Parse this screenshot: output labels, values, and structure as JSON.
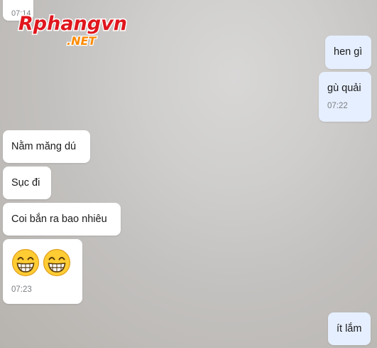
{
  "watermark": {
    "text_main": "Rphangvn",
    "text_sub": ".NET",
    "colors": {
      "main": "#e0161e",
      "sub": "#ff8a00",
      "outline": "#ffffff"
    }
  },
  "messages": [
    {
      "side": "incoming",
      "time": "07:14"
    },
    {
      "side": "outgoing",
      "text": "hen gì"
    },
    {
      "side": "outgoing",
      "text": "gù quải",
      "time": "07:22"
    },
    {
      "side": "incoming",
      "text": "Nằm măng dú"
    },
    {
      "side": "incoming",
      "text": "Sục đi"
    },
    {
      "side": "incoming",
      "text": "Coi bắn ra bao nhiêu"
    },
    {
      "side": "incoming",
      "emojis": [
        "grinning-face-icon",
        "grinning-face-icon"
      ],
      "time": "07:23"
    },
    {
      "side": "outgoing",
      "text": "ít lắm"
    }
  ],
  "colors": {
    "incoming_bubble": "#ffffff",
    "outgoing_bubble": "#e6efff",
    "timestamp": "#7b7e82",
    "emoji_face": "#ffcc33"
  }
}
